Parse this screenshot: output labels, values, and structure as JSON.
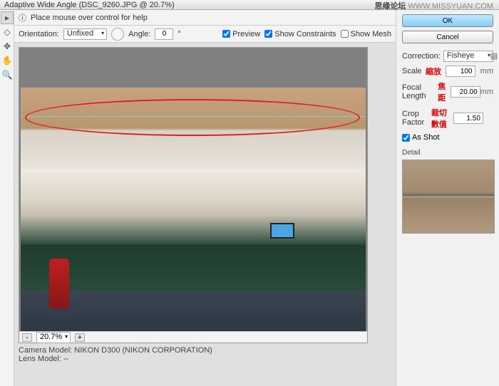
{
  "window": {
    "title": "Adaptive Wide Angle (DSC_9260.JPG @ 20.7%)"
  },
  "watermark": {
    "forum": "思缘论坛",
    "url": "WWW.MISSYUAN.COM"
  },
  "helpbar": {
    "hint": "Place mouse over control for help"
  },
  "options": {
    "orientation_label": "Orientation:",
    "orientation_value": "Unfixed",
    "angle_label": "Angle:",
    "angle_value": "0",
    "degree": "°",
    "preview_label": "Preview",
    "preview_checked": true,
    "constraints_label": "Show Constraints",
    "constraints_checked": true,
    "mesh_label": "Show Mesh",
    "mesh_checked": false
  },
  "status": {
    "zoom": "20.7%",
    "plus": "+",
    "minus": "-"
  },
  "camera": {
    "model_label": "Camera Model:",
    "model": "NIKON D300 (NIKON CORPORATION)",
    "lens_label": "Lens Model:",
    "lens": "--"
  },
  "buttons": {
    "ok": "OK",
    "cancel": "Cancel"
  },
  "panel": {
    "correction_label": "Correction:",
    "correction_value": "Fisheye",
    "scale_label": "Scale",
    "scale_value": "100",
    "scale_anno": "縮放",
    "scale_unit": "mm",
    "focal_label": "Focal Length",
    "focal_value": "20.00",
    "focal_anno": "焦距",
    "focal_unit": "mm",
    "crop_label": "Crop Factor",
    "crop_value": "1.50",
    "crop_anno": "裁切數值",
    "asshot_label": "As Shot",
    "asshot_checked": true,
    "detail_label": "Detail"
  },
  "tools": {
    "constraint": "constraint",
    "polygon": "polygon",
    "move": "move",
    "hand": "hand",
    "zoom": "zoom"
  }
}
